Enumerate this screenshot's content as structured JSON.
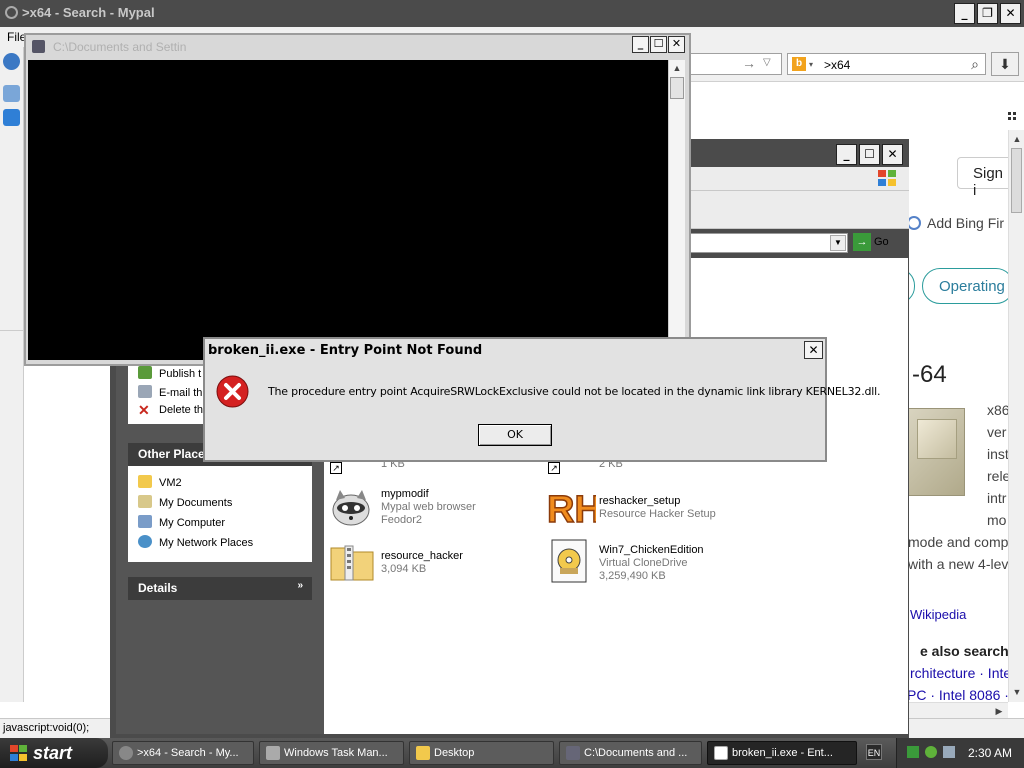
{
  "browser": {
    "title": ">x64 - Search - Mypal",
    "menu_file": "File",
    "search_value": ">x64",
    "search_engine_icon": "bing-icon",
    "sign_in": "Sign i",
    "add_bing": "Add Bing Fir",
    "pill_operating": "Operating",
    "heading": "-64",
    "snippets": [
      "x86",
      "ver",
      "inst",
      "rele",
      "intr",
      "mo",
      "mode and comp",
      "with a new 4-lev"
    ],
    "wikipedia": "Wikipedia",
    "also_search": "e also search f",
    "also_line1": "rchitecture · Inte",
    "also_line2": "PC · Intel 8086 ·",
    "status_text": "javascript:void(0);"
  },
  "explorer": {
    "go_label": "Go",
    "tasks": [
      "Publish t",
      "E-mail th",
      "Delete th"
    ],
    "other_places_title": "Other Places",
    "other_places": [
      "VM2",
      "My Documents",
      "My Computer",
      "My Network Places"
    ],
    "details_title": "Details",
    "files": [
      {
        "name": "",
        "sub1": "1 KB",
        "sub2": ""
      },
      {
        "name": "",
        "sub1": "2 KB",
        "sub2": ""
      },
      {
        "name": "mypmodif",
        "sub1": "Mypal web browser",
        "sub2": "Feodor2"
      },
      {
        "name": "reshacker_setup",
        "sub1": "Resource Hacker Setup",
        "sub2": ""
      },
      {
        "name": "resource_hacker",
        "sub1": "3,094 KB",
        "sub2": ""
      },
      {
        "name": "Win7_ChickenEdition",
        "sub1": "Virtual CloneDrive",
        "sub2": "3,259,490 KB"
      }
    ]
  },
  "console": {
    "title": "C:\\Documents and Settin"
  },
  "dialog": {
    "title": "broken_ii.exe - Entry Point Not Found",
    "message": "The procedure entry point AcquireSRWLockExclusive could not be located in the dynamic link library KERNEL32.dll.",
    "ok_label": "OK",
    "close_glyph": "✕"
  },
  "taskbar": {
    "start_label": "start",
    "buttons": [
      {
        "label": ">x64 - Search - My...",
        "icon": "browser-icon",
        "active": false
      },
      {
        "label": "Windows Task Man...",
        "icon": "task-manager-icon",
        "active": false
      },
      {
        "label": "Desktop",
        "icon": "folder-icon",
        "active": false
      },
      {
        "label": "C:\\Documents and ...",
        "icon": "console-icon",
        "active": false
      },
      {
        "label": "broken_ii.exe - Ent...",
        "icon": "window-icon",
        "active": true
      }
    ],
    "language": "EN",
    "clock": "2:30 AM"
  },
  "colors": {
    "title_dark": "#4b4b4b",
    "link": "#1a0dab",
    "pill_border": "#2b9c9c",
    "error_red": "#d42121"
  }
}
